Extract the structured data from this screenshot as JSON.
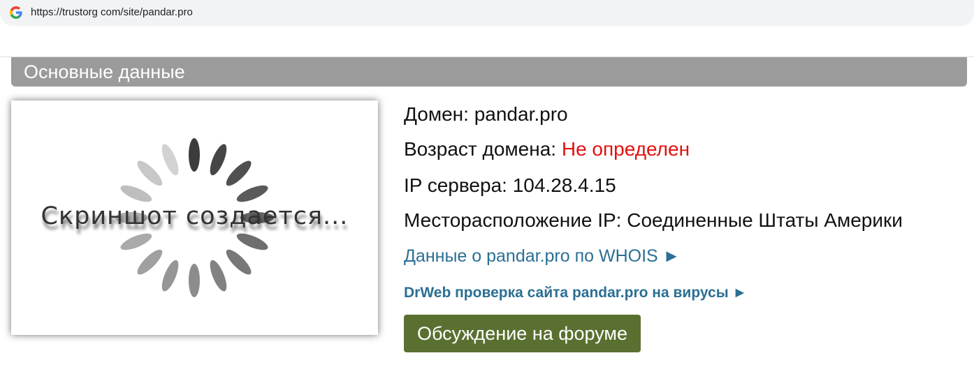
{
  "browser": {
    "url": "https://trustorg com/site/pandar.pro",
    "favicon": "google-g-icon"
  },
  "section": {
    "title": "Основные данные"
  },
  "thumbnail": {
    "caption": "Скриншот создается...",
    "icon": "loading-spinner-icon"
  },
  "info": {
    "domain_label": "Домен:",
    "domain_value": "pandar.pro",
    "age_label": "Возраст домена:",
    "age_value": "Не определен",
    "ip_label": "IP сервера:",
    "ip_value": "104.28.4.15",
    "location_label": "Месторасположение IP:",
    "location_value": "Соединенные Штаты Америки"
  },
  "links": {
    "whois": "Данные о pandar.pro по WHOIS ►",
    "drweb": "DrWeb проверка сайта pandar.pro на вирусы ►"
  },
  "buttons": {
    "forum": "Обсуждение на форуме"
  },
  "colors": {
    "header_bg": "#9b9b9b",
    "link": "#2b6f94",
    "alert": "#e0110f",
    "button_bg": "#5a7031"
  }
}
